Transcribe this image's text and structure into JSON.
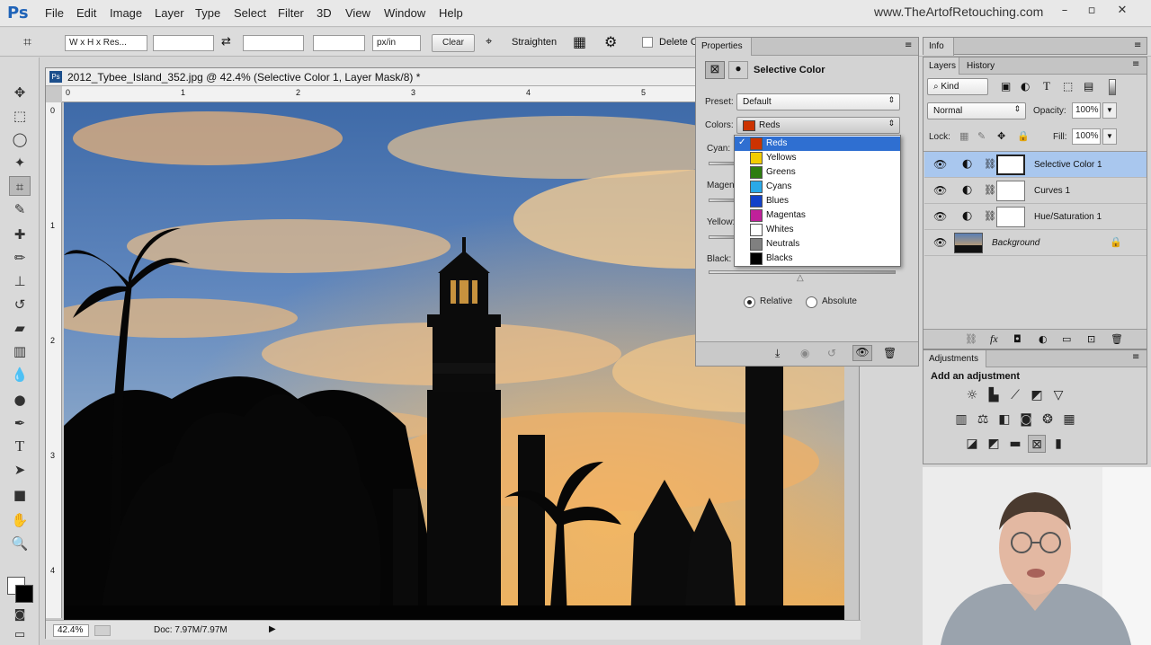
{
  "app": {
    "logo": "Ps",
    "site": "www.TheArtofRetouching.com"
  },
  "menu": [
    "File",
    "Edit",
    "Image",
    "Layer",
    "Type",
    "Select",
    "Filter",
    "3D",
    "View",
    "Window",
    "Help"
  ],
  "options": {
    "ratio": "W x H x Res...",
    "units": "px/in",
    "clear": "Clear",
    "straighten": "Straighten",
    "delete_cropped": "Delete Cr"
  },
  "document": {
    "title": "2012_Tybee_Island_352.jpg @ 42.4% (Selective Color 1, Layer Mask/8) *",
    "ruler_h": [
      "0",
      "1",
      "2",
      "3",
      "4",
      "5",
      "6"
    ],
    "ruler_v": [
      "0",
      "1",
      "2",
      "3",
      "4"
    ],
    "zoom": "42.4%",
    "doc_size": "Doc: 7.97M/7.97M"
  },
  "properties": {
    "tab": "Properties",
    "title": "Selective Color",
    "preset_label": "Preset:",
    "preset_value": "Default",
    "colors_label": "Colors:",
    "colors_value": "Reds",
    "colors_swatch": "#cc3300",
    "cyan_label": "Cyan:",
    "magenta_label": "Magen",
    "yellow_label": "Yellow:",
    "black_label": "Black:",
    "relative": "Relative",
    "absolute": "Absolute",
    "method_selected": "Relative"
  },
  "dropdown": {
    "selected": "Reds",
    "items": [
      {
        "label": "Reds",
        "color": "#cc3300"
      },
      {
        "label": "Yellows",
        "color": "#f2cc00"
      },
      {
        "label": "Greens",
        "color": "#2e7d10"
      },
      {
        "label": "Cyans",
        "color": "#2aa9e8"
      },
      {
        "label": "Blues",
        "color": "#1241c9"
      },
      {
        "label": "Magentas",
        "color": "#c0209a"
      },
      {
        "label": "Whites",
        "color": "#ffffff"
      },
      {
        "label": "Neutrals",
        "color": "#808080"
      },
      {
        "label": "Blacks",
        "color": "#000000"
      }
    ]
  },
  "info_panel": {
    "tab": "Info"
  },
  "layers_panel": {
    "tabs": [
      "Layers",
      "History"
    ],
    "kind": "Kind",
    "blend": "Normal",
    "opacity_label": "Opacity:",
    "opacity": "100%",
    "lock_label": "Lock:",
    "fill_label": "Fill:",
    "fill": "100%",
    "layers": [
      {
        "name": "Selective Color 1",
        "selected": true
      },
      {
        "name": "Curves 1",
        "selected": false
      },
      {
        "name": "Hue/Saturation 1",
        "selected": false
      },
      {
        "name": "Background",
        "selected": false
      }
    ]
  },
  "adjustments_panel": {
    "tab": "Adjustments",
    "title": "Add an adjustment"
  }
}
